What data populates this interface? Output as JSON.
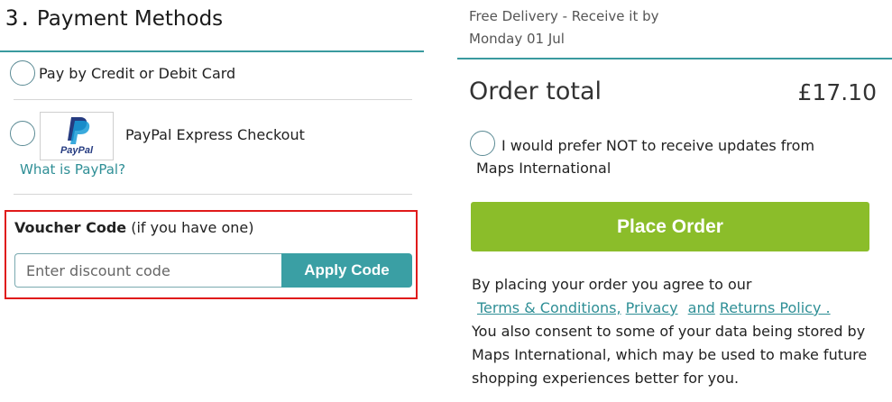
{
  "payment": {
    "step_number": "3.",
    "heading": "Payment Methods",
    "options": [
      {
        "label": "Pay by Credit or Debit Card"
      },
      {
        "label": "PayPal Express Checkout",
        "logo_text": "PayPal",
        "help_link": "What is PayPal?"
      }
    ]
  },
  "voucher": {
    "title_bold": "Voucher Code",
    "title_note": "(if you have one)",
    "placeholder": "Enter discount code",
    "apply_label": "Apply Code"
  },
  "delivery": {
    "line1": "Free Delivery - Receive it by",
    "line2": "Monday 01 Jul"
  },
  "order": {
    "total_label": "Order total",
    "total_value": "£17.10",
    "optout_line1": "I would prefer NOT to receive updates from",
    "optout_line2": "Maps International",
    "place_order_label": "Place Order"
  },
  "legal": {
    "intro": "By placing your order you agree to our",
    "terms_link": "Terms & Conditions,",
    "privacy_link": "Privacy",
    "and_link": "and",
    "returns_link": "Returns Policy .",
    "consent": "You also consent to some of your data being stored by Maps International, which may be used to make future shopping experiences better for you."
  },
  "colors": {
    "teal": "#3a9fa4",
    "green_button": "#8bbd2a",
    "highlight_red": "#e01b1b",
    "paypal_dark": "#253b80",
    "paypal_light": "#179bd7"
  },
  "icons": [
    "radio-unchecked-icon",
    "paypal-logo-icon"
  ]
}
